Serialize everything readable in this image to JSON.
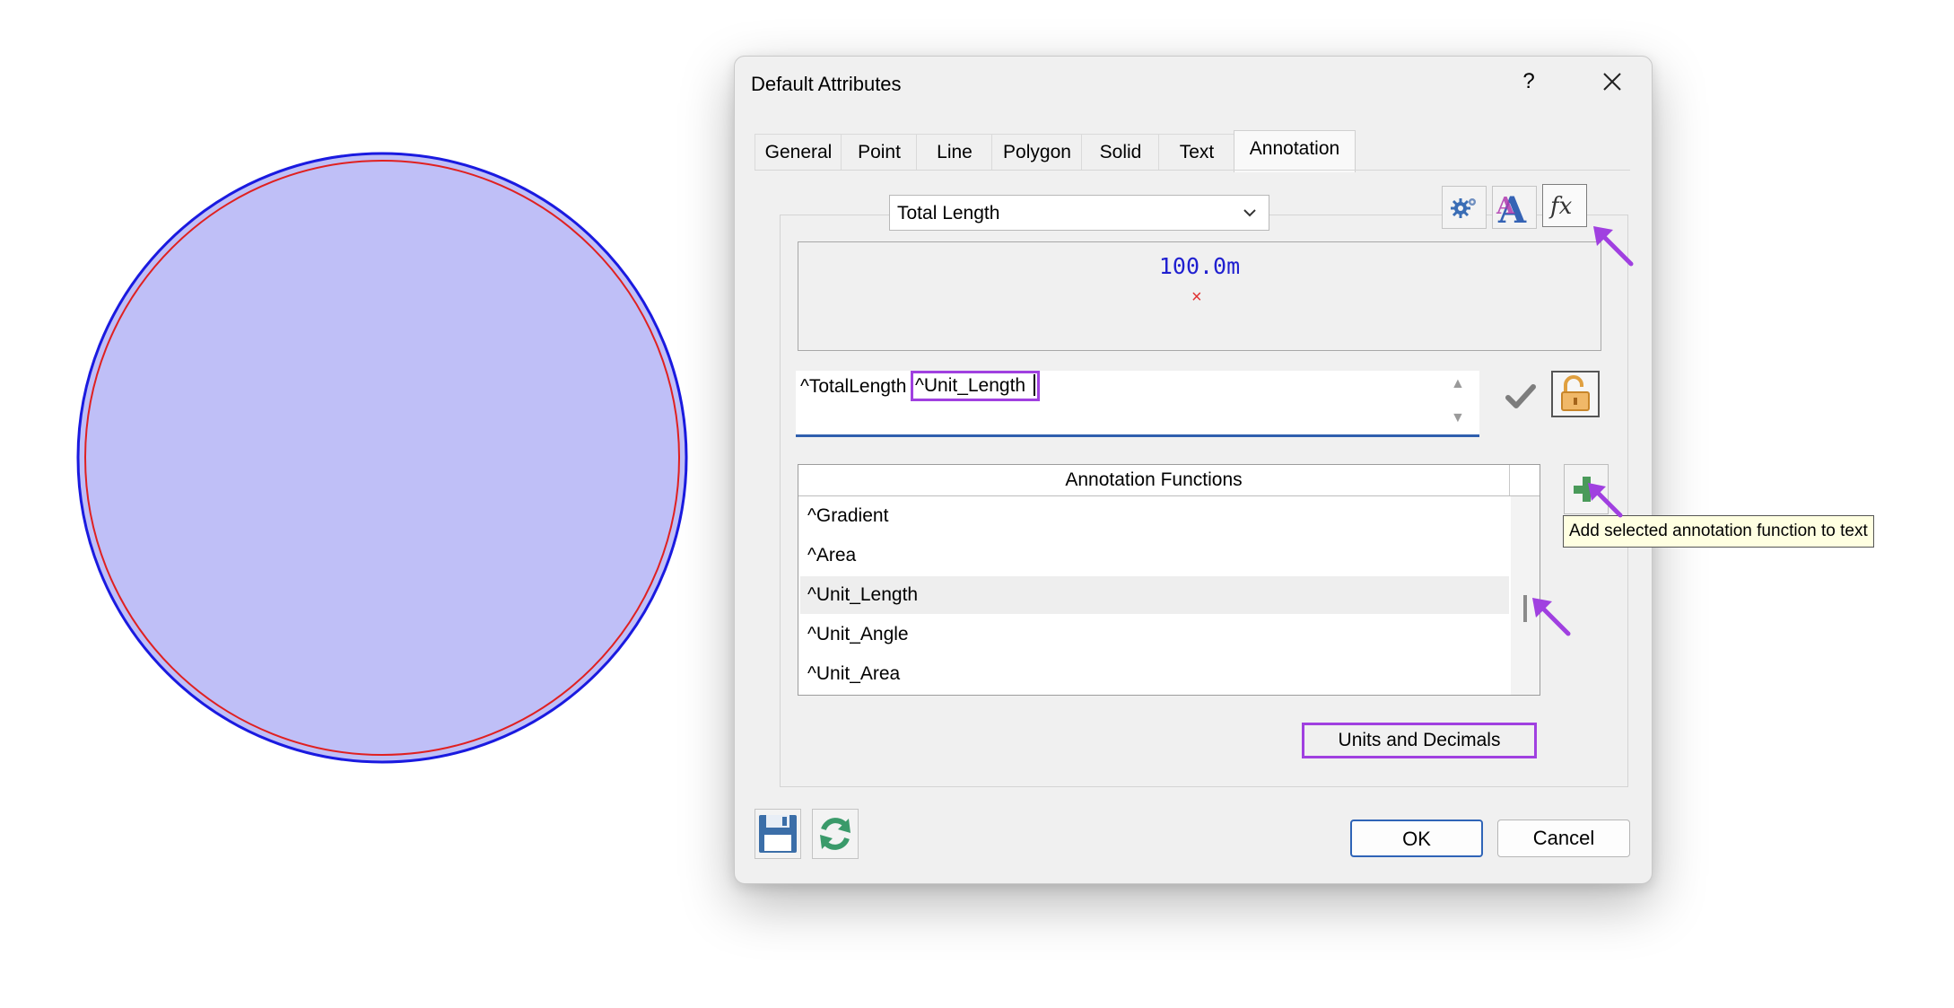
{
  "dialog": {
    "title": "Default Attributes",
    "help_label": "?",
    "tabs": [
      {
        "label": "General"
      },
      {
        "label": "Point"
      },
      {
        "label": "Line"
      },
      {
        "label": "Polygon"
      },
      {
        "label": "Solid"
      },
      {
        "label": "Text"
      },
      {
        "label": "Annotation",
        "active": true
      }
    ],
    "annotation": {
      "dropdown_value": "Total Length",
      "toolbar_icons": [
        "gears-icon",
        "font-style-icon",
        "function-icon"
      ],
      "preview_value": "100.0m",
      "preview_marker": "×",
      "text_prefix": "^TotalLength",
      "text_highlight": "^Unit_Length",
      "list_header": "Annotation Functions",
      "functions": [
        {
          "label": "^Gradient"
        },
        {
          "label": "^Area"
        },
        {
          "label": "^Unit_Length",
          "selected": true
        },
        {
          "label": "^Unit_Angle"
        },
        {
          "label": "^Unit_Area"
        }
      ],
      "tooltip": "Add selected annotation function to text",
      "units_button": "Units and Decimals"
    },
    "ok_label": "OK",
    "cancel_label": "Cancel"
  },
  "colors": {
    "circle_fill": "#bfbff7",
    "circle_outline": "#1a1ae0",
    "circle_inner_outline": "#e02020",
    "highlight": "#a040e0",
    "preview_text": "#2020d0"
  }
}
